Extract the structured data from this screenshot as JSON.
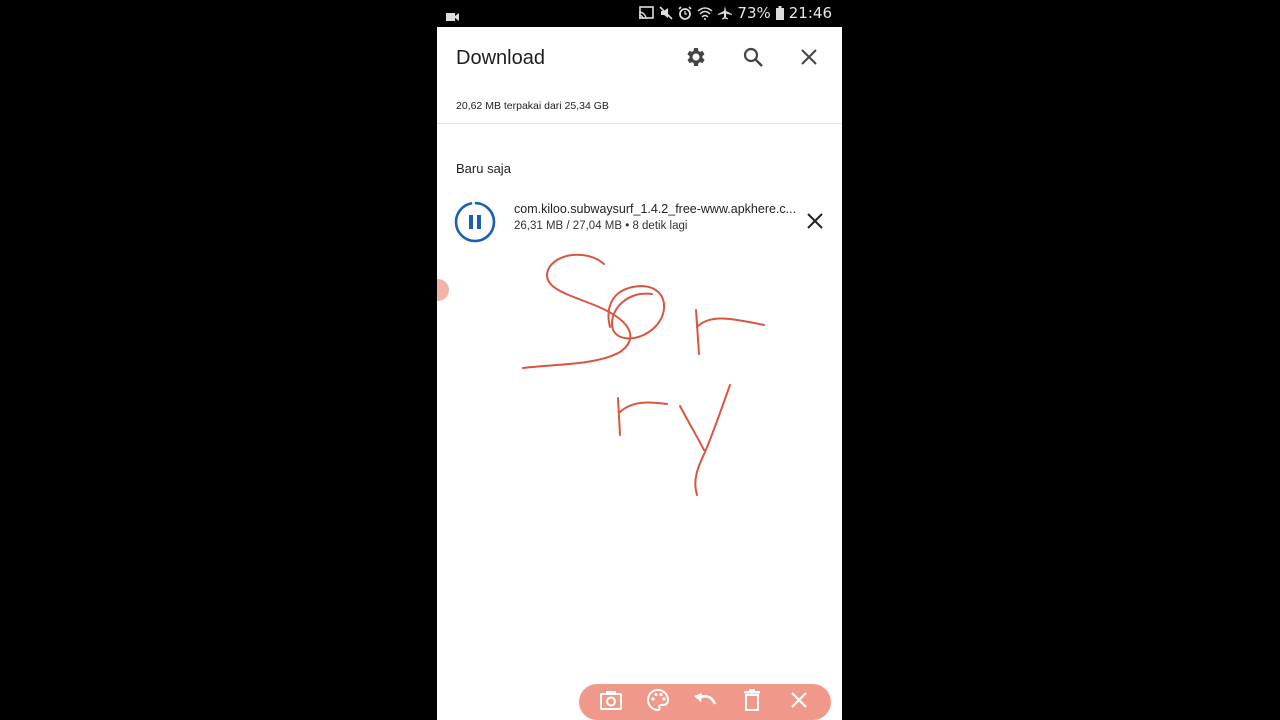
{
  "status_bar": {
    "left_icon": "video-camera-icon",
    "icons": [
      "screen-cast-icon",
      "mute-icon",
      "alarm-icon",
      "wifi-icon",
      "airplane-mode-icon"
    ],
    "battery": "73%",
    "time": "21:46"
  },
  "header": {
    "title": "Download",
    "settings_icon": "gear-icon",
    "search_icon": "search-icon",
    "close_icon": "close-icon"
  },
  "storage": {
    "text": "20,62 MB terpakai dari 25,34 GB"
  },
  "section": {
    "label": "Baru saja"
  },
  "download_item": {
    "filename": "com.kiloo.subwaysurf_1.4.2_free-www.apkhere.c...",
    "meta": "26,31 MB / 27,04 MB • 8 detik lagi",
    "progress": 0.973,
    "state": "downloading",
    "action_icon": "pause-icon",
    "cancel_icon": "close-icon"
  },
  "annotation": {
    "handwritten_text": "Sorry",
    "color": "#d9553f"
  },
  "annotation_toolbar": {
    "color": "#f0998a",
    "buttons": [
      {
        "name": "screenshot",
        "icon": "camera-icon"
      },
      {
        "name": "color",
        "icon": "palette-icon"
      },
      {
        "name": "undo",
        "icon": "undo-icon"
      },
      {
        "name": "delete",
        "icon": "trash-icon"
      },
      {
        "name": "close",
        "icon": "close-icon"
      }
    ]
  },
  "colors": {
    "accent": "#1a5fb4",
    "text": "#1f1f1f"
  }
}
